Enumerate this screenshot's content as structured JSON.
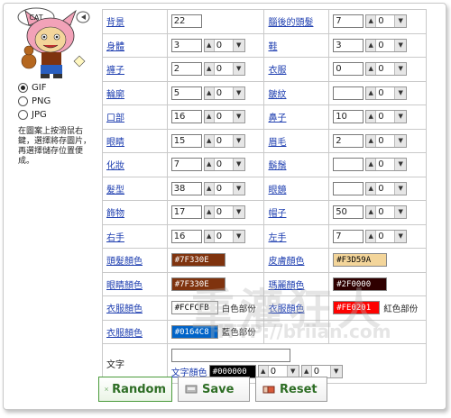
{
  "avatar": {
    "bubble_text": "CAT"
  },
  "format": {
    "options": [
      {
        "label": "GIF",
        "selected": true
      },
      {
        "label": "PNG",
        "selected": false
      },
      {
        "label": "JPG",
        "selected": false
      }
    ],
    "tip": "在圖案上按滑鼠右鍵，選擇將存圖片，再選擇儲存位置便成。"
  },
  "rows": [
    {
      "l_label": "背景",
      "l_value": "22",
      "l_select": "",
      "r_label": "腦後的頭髮",
      "r_value": "7",
      "r_select": "0"
    },
    {
      "l_label": "身體",
      "l_value": "3",
      "l_select": "0",
      "r_label": "鞋",
      "r_value": "3",
      "r_select": "0"
    },
    {
      "l_label": "褲子",
      "l_value": "2",
      "l_select": "0",
      "r_label": "衣服",
      "r_value": "0",
      "r_select": "0"
    },
    {
      "l_label": "輪廓",
      "l_value": "5",
      "l_select": "0",
      "r_label": "皺紋",
      "r_value": "",
      "r_select": "0"
    },
    {
      "l_label": "口部",
      "l_value": "16",
      "l_select": "0",
      "r_label": "鼻子",
      "r_value": "10",
      "r_select": "0"
    },
    {
      "l_label": "眼睛",
      "l_value": "15",
      "l_select": "0",
      "r_label": "眉毛",
      "r_value": "2",
      "r_select": "0"
    },
    {
      "l_label": "化妝",
      "l_value": "7",
      "l_select": "0",
      "r_label": "鬍鬚",
      "r_value": "",
      "r_select": "0"
    },
    {
      "l_label": "髮型",
      "l_value": "38",
      "l_select": "0",
      "r_label": "眼鏡",
      "r_value": "",
      "r_select": "0"
    },
    {
      "l_label": "飾物",
      "l_value": "17",
      "l_select": "0",
      "r_label": "帽子",
      "r_value": "50",
      "r_select": "0"
    },
    {
      "l_label": "右手",
      "l_value": "16",
      "l_select": "0",
      "r_label": "左手",
      "r_value": "7",
      "r_select": "0"
    }
  ],
  "colors": [
    {
      "l_label": "頭髮顏色",
      "l_hex": "#7F330E",
      "l_bg": "#7F330E",
      "l_fg": "#ffffff",
      "r_label": "皮膚顏色",
      "r_hex": "#F3D59A",
      "r_bg": "#F3D59A",
      "r_fg": "#000000"
    },
    {
      "l_label": "眼睛顏色",
      "l_hex": "#7F330E",
      "l_bg": "#7F330E",
      "l_fg": "#ffffff",
      "r_label": "瑪麗顏色",
      "r_hex": "#2F0000",
      "r_bg": "#2F0000",
      "r_fg": "#ffffff"
    },
    {
      "l_label": "衣服顏色",
      "l_hex": "#FCFCFB",
      "l_bg": "#FCFCFB",
      "l_fg": "#000000",
      "l_note": "白色部份",
      "r_label": "衣服顏色",
      "r_hex": "#FE0201",
      "r_bg": "#FE0201",
      "r_fg": "#ffffff",
      "r_note": "紅色部份"
    },
    {
      "l_label": "衣服顏色",
      "l_hex": "#0164C8",
      "l_bg": "#0164C8",
      "l_fg": "#ffffff",
      "l_note": "藍色部份"
    }
  ],
  "text_row": {
    "label": "文字",
    "color_label": "文字顏色",
    "color_hex": "#000000",
    "select_a": "0",
    "select_b": "0"
  },
  "buttons": {
    "random": "Random",
    "save": "Save",
    "reset": "Reset"
  },
  "watermark": {
    "big": "重灌狂人",
    "small": "HTTP://briian.com"
  }
}
